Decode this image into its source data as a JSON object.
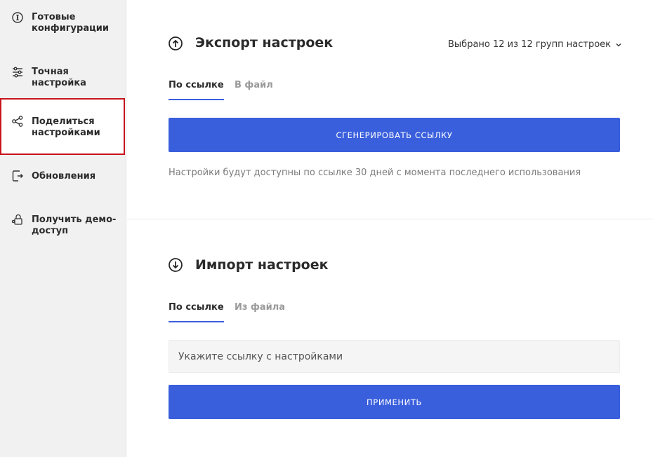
{
  "sidebar": {
    "items": [
      {
        "label": "Готовые конфигурации",
        "icon": "configurations-icon",
        "selected": false
      },
      {
        "label": "Точная настройка",
        "icon": "sliders-icon",
        "selected": false
      },
      {
        "label": "Поделиться настройками",
        "icon": "share-icon",
        "selected": true
      },
      {
        "label": "Обновления",
        "icon": "update-icon",
        "selected": false
      },
      {
        "label": "Получить демо-доступ",
        "icon": "demo-access-icon",
        "selected": false
      }
    ]
  },
  "export": {
    "title": "Экспорт настроек",
    "icon": "upload-circle-icon",
    "selector_label": "Выбрано 12 из 12 групп настроек",
    "tabs": [
      {
        "label": "По ссылке",
        "active": true
      },
      {
        "label": "В файл",
        "active": false
      }
    ],
    "generate_button": "СГЕНЕРИРОВАТЬ ССЫЛКУ",
    "hint": "Настройки будут доступны по ссылке 30 дней с момента последнего использования"
  },
  "import": {
    "title": "Импорт настроек",
    "icon": "download-circle-icon",
    "tabs": [
      {
        "label": "По ссылке",
        "active": true
      },
      {
        "label": "Из файла",
        "active": false
      }
    ],
    "input_placeholder": "Укажите ссылку с настройками",
    "input_value": "",
    "apply_button": "ПРИМЕНИТЬ"
  },
  "colors": {
    "accent": "#3a5fdd",
    "highlight_border": "#c8141c",
    "sidebar_bg": "#f1f1f1"
  }
}
